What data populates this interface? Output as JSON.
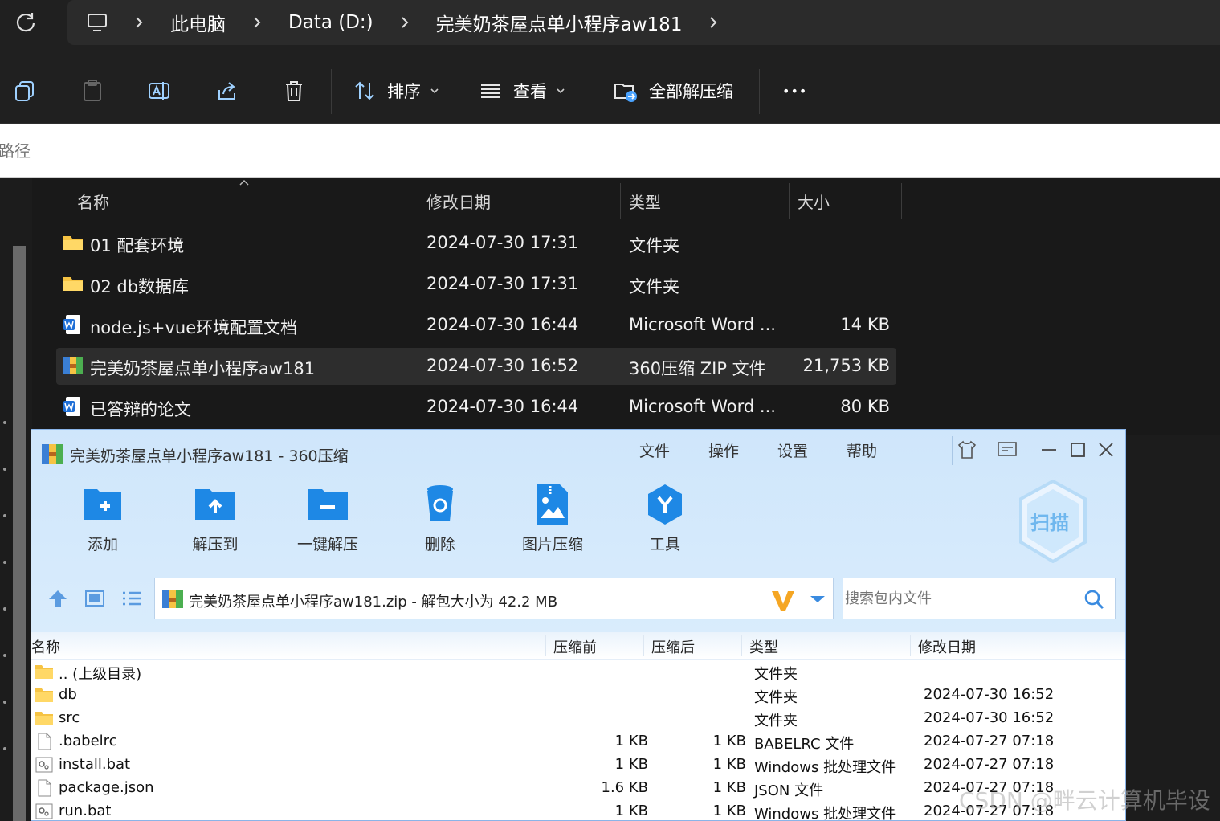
{
  "breadcrumb": {
    "items": [
      "此电脑",
      "Data (D:)",
      "完美奶茶屋点单小程序aw181"
    ]
  },
  "toolbar": {
    "sort_label": "排序",
    "view_label": "查看",
    "extract_all_label": "全部解压缩",
    "more_label": "•••"
  },
  "path_input": {
    "placeholder": "件路径"
  },
  "explorer": {
    "columns": [
      "名称",
      "修改日期",
      "类型",
      "大小"
    ],
    "rows": [
      {
        "name": "01 配套环境",
        "date": "2024-07-30 17:31",
        "type": "文件夹",
        "size": "",
        "icon": "folder-icon"
      },
      {
        "name": "02 db数据库",
        "date": "2024-07-30 17:31",
        "type": "文件夹",
        "size": "",
        "icon": "folder-icon"
      },
      {
        "name": "node.js+vue环境配置文档",
        "date": "2024-07-30 16:44",
        "type": "Microsoft Word ...",
        "size": "14 KB",
        "icon": "word-doc-icon"
      },
      {
        "name": "完美奶茶屋点单小程序aw181",
        "date": "2024-07-30 16:52",
        "type": "360压缩 ZIP 文件",
        "size": "21,753 KB",
        "icon": "zip-archive-icon",
        "selected": true
      },
      {
        "name": "已答辩的论文",
        "date": "2024-07-30 16:44",
        "type": "Microsoft Word ...",
        "size": "80 KB",
        "icon": "word-doc-icon"
      }
    ]
  },
  "zip_window": {
    "title": "完美奶茶屋点单小程序aw181 - 360压缩",
    "menu": [
      "文件",
      "操作",
      "设置",
      "帮助"
    ],
    "buttons": [
      "添加",
      "解压到",
      "一键解压",
      "删除",
      "图片压缩",
      "工具"
    ],
    "scan_label": "扫描",
    "address_text": "完美奶茶屋点单小程序aw181.zip - 解包大小为 42.2 MB",
    "search_placeholder": "搜索包内文件",
    "columns": [
      "名称",
      "压缩前",
      "压缩后",
      "类型",
      "修改日期"
    ],
    "rows": [
      {
        "name": ".. (上级目录)",
        "before": "",
        "after": "",
        "type": "文件夹",
        "date": "",
        "icon": "folder-icon"
      },
      {
        "name": "db",
        "before": "",
        "after": "",
        "type": "文件夹",
        "date": "2024-07-30 16:52",
        "icon": "folder-icon"
      },
      {
        "name": "src",
        "before": "",
        "after": "",
        "type": "文件夹",
        "date": "2024-07-30 16:52",
        "icon": "folder-icon"
      },
      {
        "name": ".babelrc",
        "before": "1 KB",
        "after": "1 KB",
        "type": "BABELRC 文件",
        "date": "2024-07-27 07:18",
        "icon": "file-icon"
      },
      {
        "name": "install.bat",
        "before": "1 KB",
        "after": "1 KB",
        "type": "Windows 批处理文件",
        "date": "2024-07-27 07:18",
        "icon": "batch-file-icon"
      },
      {
        "name": "package.json",
        "before": "1.6 KB",
        "after": "1 KB",
        "type": "JSON 文件",
        "date": "2024-07-27 07:18",
        "icon": "file-icon"
      },
      {
        "name": "run.bat",
        "before": "1 KB",
        "after": "1 KB",
        "type": "Windows 批处理文件",
        "date": "2024-07-27 07:18",
        "icon": "batch-file-icon"
      }
    ]
  },
  "watermark": "CSDN @畔云计算机毕设",
  "colors": {
    "explorer_bg": "#1c1c1c",
    "zip_header_bg": "#d4e8fb",
    "zip_accent": "#1e88e5",
    "folder": "#f6c343"
  }
}
